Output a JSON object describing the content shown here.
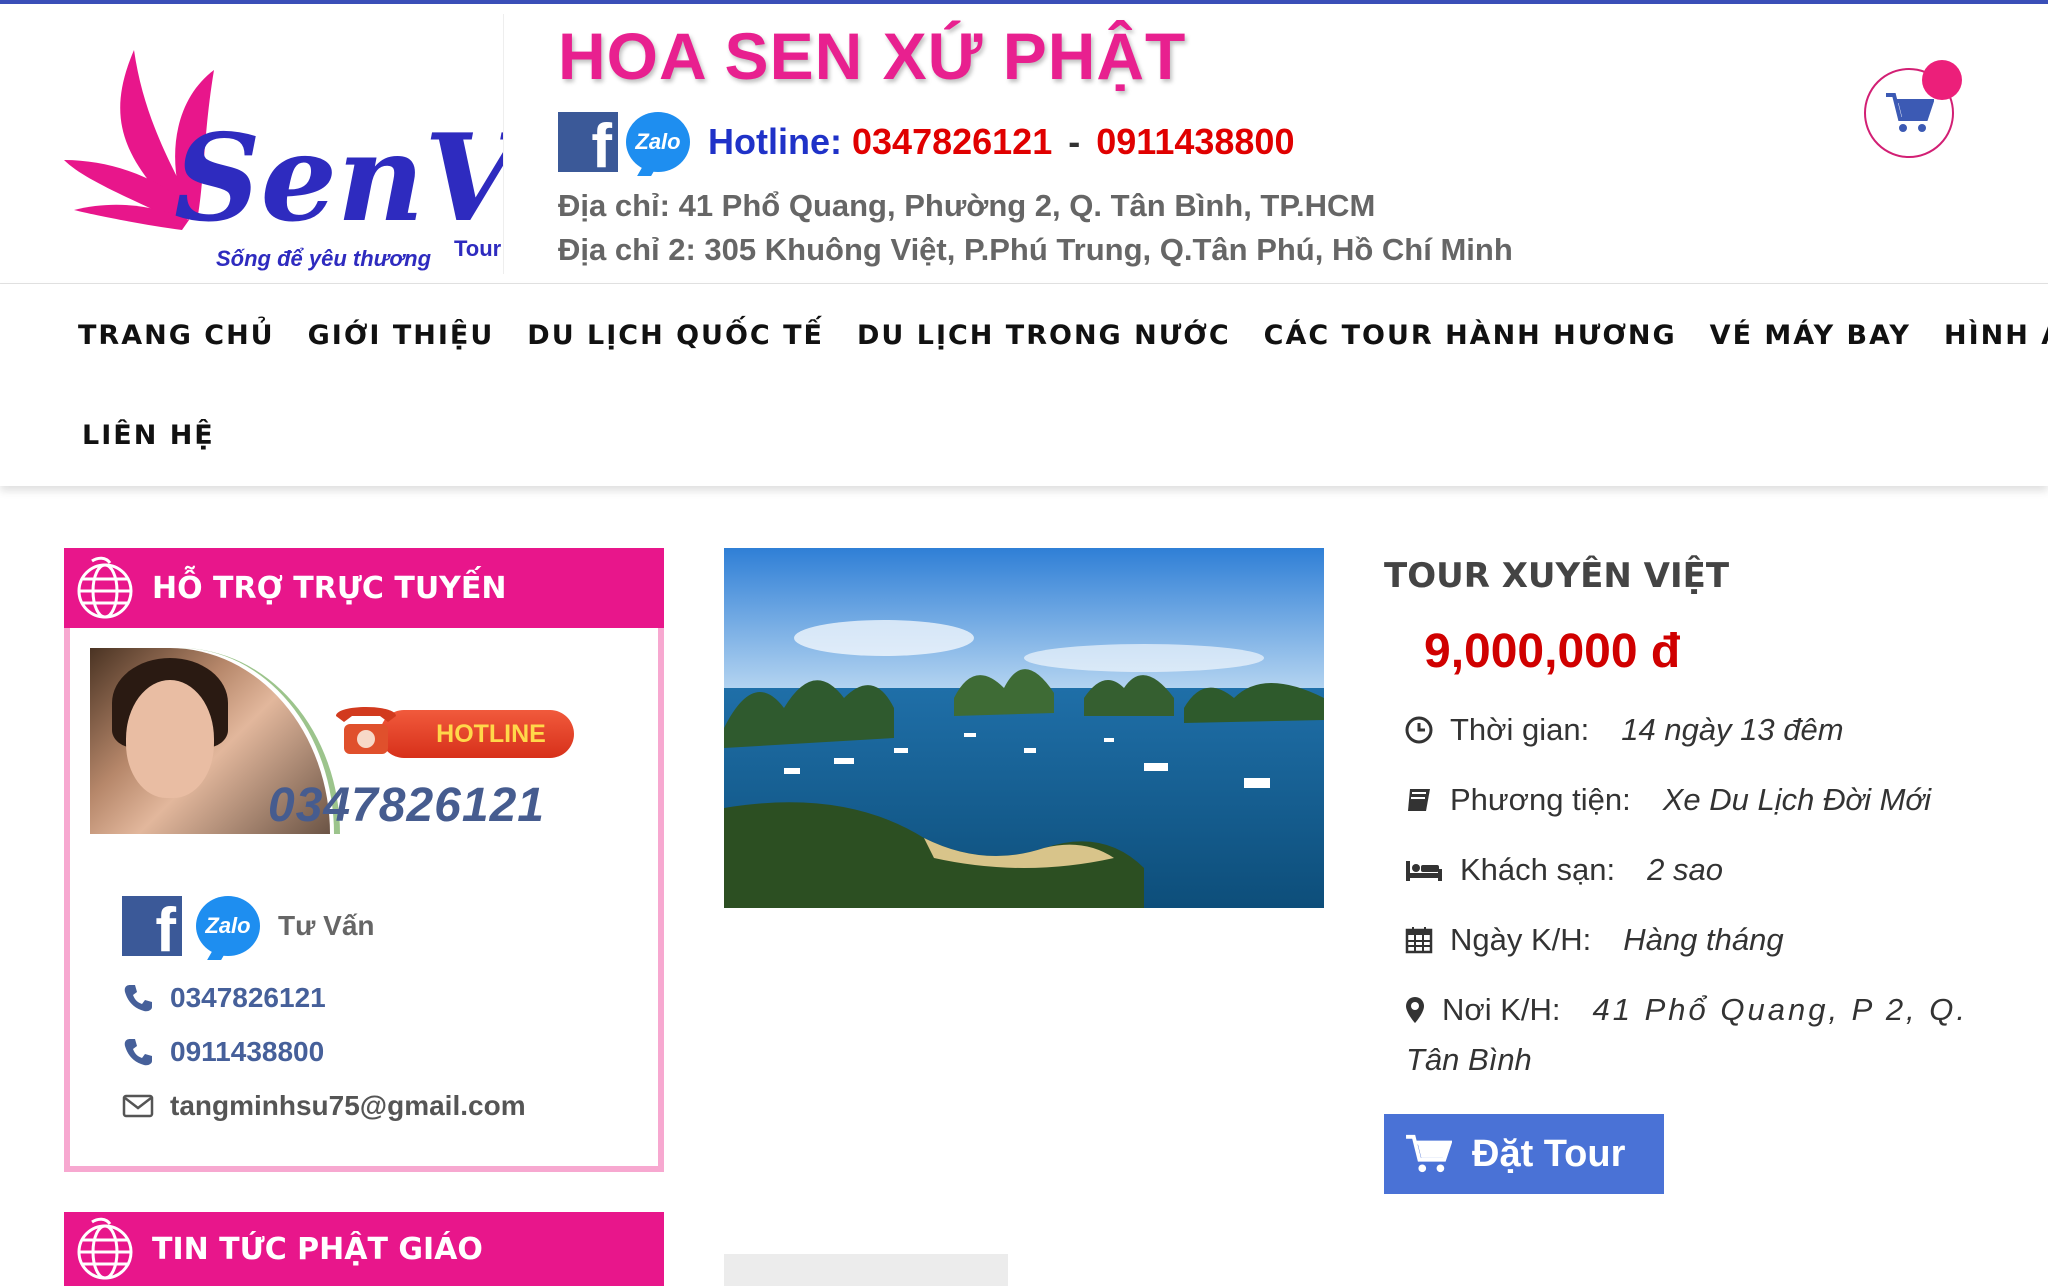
{
  "header": {
    "logo_text": "SenViet",
    "logo_tour": "Tour",
    "logo_slogan": "Sống để yêu thương",
    "site_title": "HOA SEN XỨ PHẬT",
    "hotline_label": "Hotline:",
    "hotline_1": "0347826121",
    "hotline_separator": "-",
    "hotline_2": "0911438800",
    "address_1": "Địa chỉ: 41 Phổ Quang, Phường 2, Q. Tân Bình, TP.HCM",
    "address_2": "Địa chỉ 2: 305 Khuông Việt, P.Phú Trung, Q.Tân Phú, Hồ Chí Minh",
    "zalo_label": "Zalo",
    "facebook_label": "f"
  },
  "nav": {
    "items": [
      "TRANG CHỦ",
      "GIỚI THIỆU",
      "DU LỊCH QUỐC TẾ",
      "DU LỊCH TRONG NƯỚC",
      "CÁC TOUR HÀNH HƯƠNG",
      "VÉ MÁY BAY",
      "HÌNH ẢNH",
      "LIÊN HỆ"
    ]
  },
  "sidebar": {
    "support_title": "HỖ TRỢ TRỰC TUYẾN",
    "banner_hotline": "HOTLINE",
    "banner_number": "0347826121",
    "tuvan_label": "Tư Vấn",
    "phone_1": "0347826121",
    "phone_2": "0911438800",
    "email": "tangminhsu75@gmail.com",
    "news_title": "TIN TỨC PHẬT GIÁO"
  },
  "tour": {
    "name": "TOUR XUYÊN VIỆT",
    "price": "9,000,000 đ",
    "duration_label": "Thời gian:",
    "duration_value": "14 ngày 13 đêm",
    "transport_label": "Phương tiện:",
    "transport_value": "Xe Du Lịch Đời Mới",
    "hotel_label": "Khách sạn:",
    "hotel_value": "2 sao",
    "departure_label": "Ngày K/H:",
    "departure_value": "Hàng tháng",
    "location_label": "Nơi K/H:",
    "location_value": "41 Phổ Quang, P 2, Q.",
    "location_value_cont": "Tân Bình",
    "book_label": "Đặt Tour"
  },
  "colors": {
    "brand_pink": "#e8168b",
    "hotline_blue": "#1f32c8",
    "price_red": "#d00000",
    "button_blue": "#4a72d6"
  }
}
